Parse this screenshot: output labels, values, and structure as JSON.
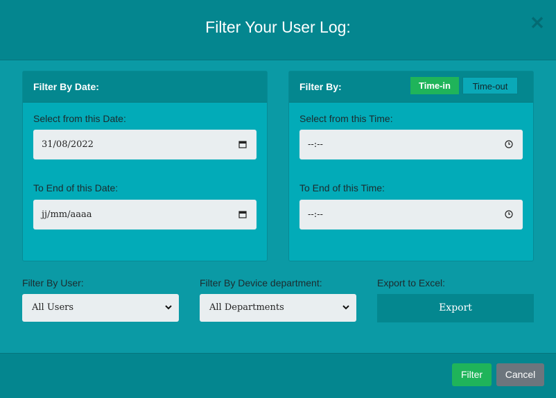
{
  "modal": {
    "title": "Filter Your User Log:",
    "close_icon": "close-icon"
  },
  "date_panel": {
    "heading": "Filter By Date:",
    "from_label": "Select from this Date:",
    "from_value": "31/08/2022",
    "to_label": "To End of this Date:",
    "to_value": "jj/mm/aaaa",
    "icon": "calendar-icon"
  },
  "time_panel": {
    "heading": "Filter By:",
    "tabs": [
      {
        "label": "Time-in",
        "active": true
      },
      {
        "label": "Time-out",
        "active": false
      }
    ],
    "from_label": "Select from this Time:",
    "from_value": "--:--",
    "to_label": "To End of this Time:",
    "to_value": "--:--",
    "icon": "clock-icon"
  },
  "user_filter": {
    "label": "Filter By User:",
    "selected": "All Users"
  },
  "department_filter": {
    "label": "Filter By Device department:",
    "selected": "All Departments"
  },
  "export": {
    "label": "Export to Excel:",
    "button": "Export"
  },
  "footer": {
    "filter_button": "Filter",
    "cancel_button": "Cancel"
  },
  "colors": {
    "accent_green": "#1fb45a",
    "teal_dark": "#04868f",
    "teal_light": "#02abb8",
    "gray_button": "#6c757d"
  }
}
